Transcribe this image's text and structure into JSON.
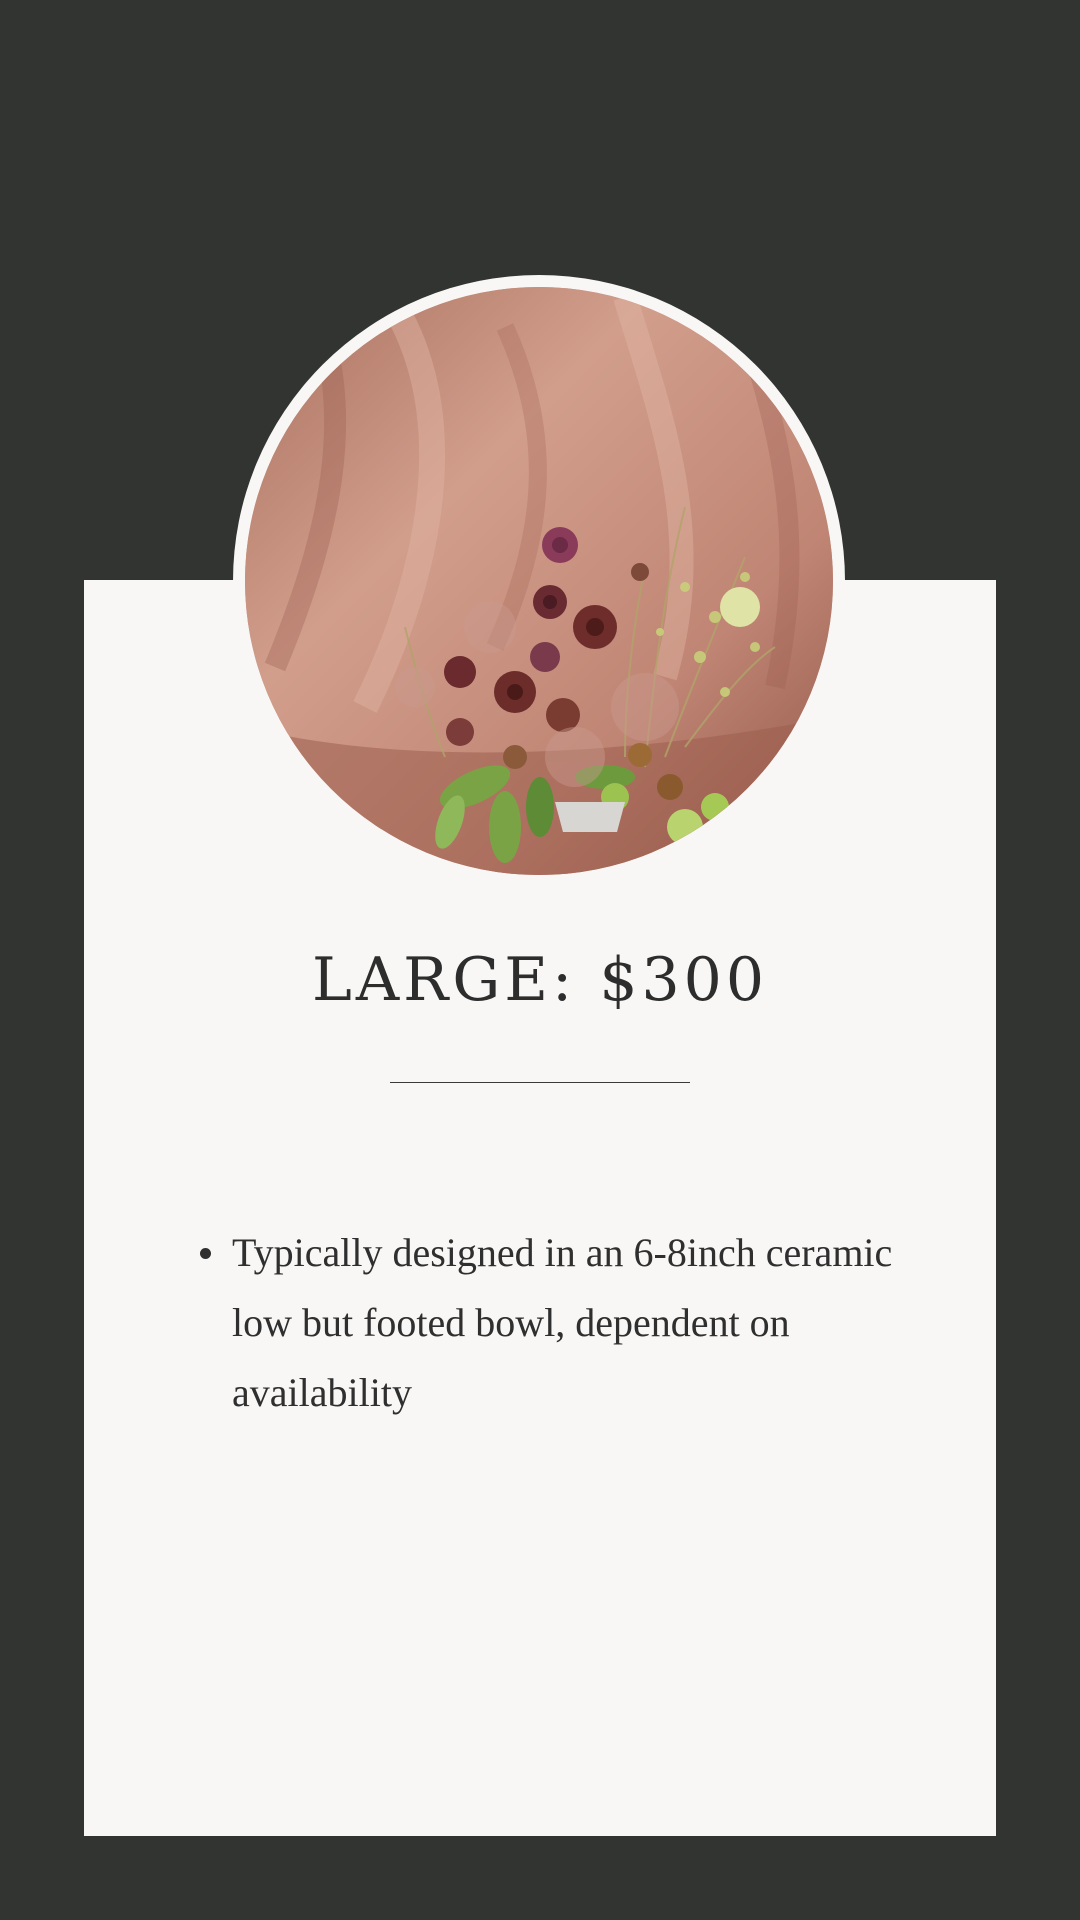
{
  "product": {
    "title": "LARGE:  $300",
    "image_subject": "floral arrangement on pink draped cloth",
    "features": [
      "Typically designed in an 6-8inch ceramic low but footed bowl, dependent on availability"
    ]
  },
  "colors": {
    "background": "#323432",
    "card": "#f8f7f5",
    "text": "#2d2d2d",
    "drape": "#c48d7c"
  }
}
